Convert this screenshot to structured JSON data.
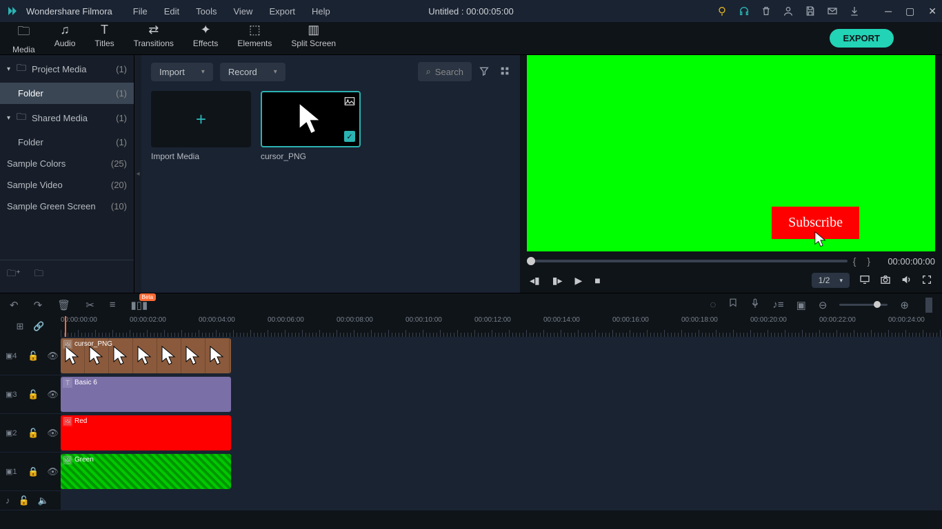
{
  "app": {
    "name": "Wondershare Filmora",
    "title": "Untitled : 00:00:05:00"
  },
  "menu": [
    "File",
    "Edit",
    "Tools",
    "View",
    "Export",
    "Help"
  ],
  "toolbar": {
    "tabs": [
      {
        "icon": "folder",
        "label": "Media"
      },
      {
        "icon": "music",
        "label": "Audio"
      },
      {
        "icon": "text",
        "label": "Titles"
      },
      {
        "icon": "transition",
        "label": "Transitions"
      },
      {
        "icon": "sparkle",
        "label": "Effects"
      },
      {
        "icon": "elements",
        "label": "Elements"
      },
      {
        "icon": "split",
        "label": "Split Screen"
      }
    ],
    "export": "EXPORT"
  },
  "sidebar": {
    "items": [
      {
        "label": "Project Media",
        "count": "(1)",
        "expandable": true
      },
      {
        "label": "Folder",
        "count": "(1)",
        "selected": true,
        "child": true
      },
      {
        "label": "Shared Media",
        "count": "(1)",
        "expandable": true
      },
      {
        "label": "Folder",
        "count": "(1)",
        "child": true
      },
      {
        "label": "Sample Colors",
        "count": "(25)"
      },
      {
        "label": "Sample Video",
        "count": "(20)"
      },
      {
        "label": "Sample Green Screen",
        "count": "(10)"
      }
    ]
  },
  "mediaPanel": {
    "import": "Import",
    "record": "Record",
    "searchPlaceholder": "Search",
    "importTile": "Import Media",
    "tile1": "cursor_PNG"
  },
  "preview": {
    "subscribe": "Subscribe",
    "timecode": "00:00:00:00",
    "ratio": "1/2"
  },
  "ruler": {
    "marks": [
      "00:00:00:00",
      "00:00:02:00",
      "00:00:04:00",
      "00:00:06:00",
      "00:00:08:00",
      "00:00:10:00",
      "00:00:12:00",
      "00:00:14:00",
      "00:00:16:00",
      "00:00:18:00",
      "00:00:20:00",
      "00:00:22:00",
      "00:00:24:00"
    ]
  },
  "tracks": {
    "t4": {
      "label": "4",
      "clip": "cursor_PNG"
    },
    "t3": {
      "label": "3",
      "clip": "Basic 6"
    },
    "t2": {
      "label": "2",
      "clip": "Red"
    },
    "t1": {
      "label": "1",
      "clip": "Green"
    }
  },
  "badges": {
    "beta": "Beta"
  }
}
